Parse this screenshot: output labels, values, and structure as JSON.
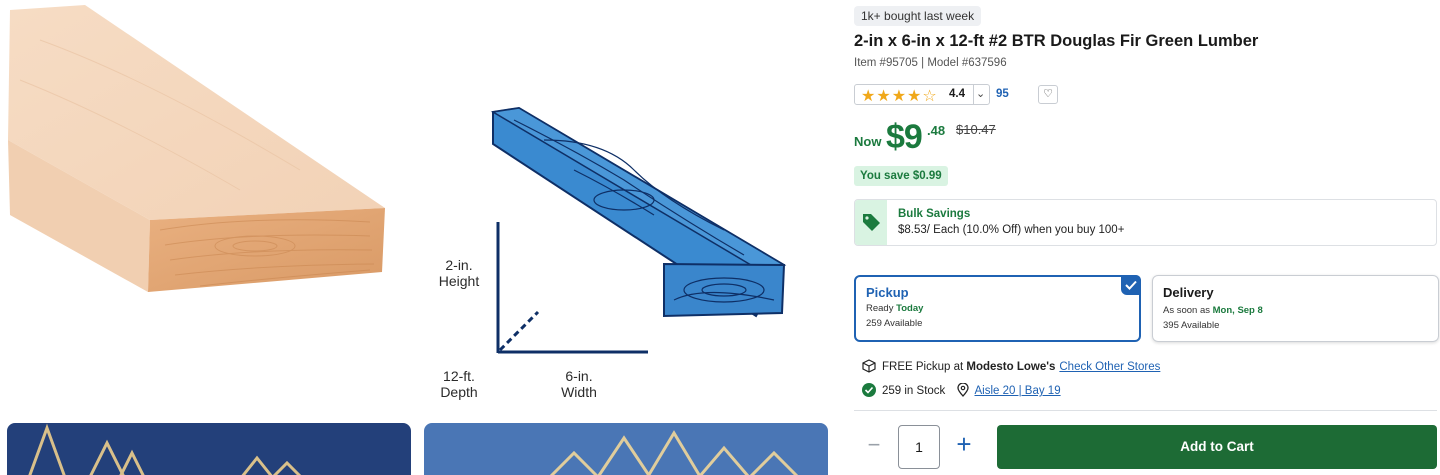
{
  "gallery": {
    "diagram": {
      "height_label": "2-in.\nHeight",
      "depth_label": "12-ft.\nDepth",
      "width_label": "6-in.\nWidth"
    }
  },
  "product": {
    "badge": "1k+ bought last week",
    "title": "2-in x 6-in x 12-ft #2 BTR Douglas Fir Green Lumber",
    "item_line": "Item #95705 | Model #637596",
    "rating": "4.4",
    "review_count": "95",
    "price_prefix": "Now",
    "price_dollars": "$9",
    "price_cents": ".48",
    "price_was": "$10.47",
    "savings": "You save $0.99"
  },
  "bulk": {
    "title": "Bulk Savings",
    "text": "$8.53/ Each (10.0% Off) when you buy 100+"
  },
  "fulfillment": {
    "pickup": {
      "title": "Pickup",
      "ready_prefix": "Ready",
      "ready_value": "Today",
      "available": "259 Available"
    },
    "delivery": {
      "title": "Delivery",
      "eta_prefix": "As soon as",
      "eta_value": "Mon, Sep 8",
      "available": "395 Available"
    }
  },
  "store": {
    "pickup_prefix": "FREE Pickup at",
    "store_name": "Modesto Lowe's",
    "check_other": "Check Other Stores",
    "stock": "259 in Stock",
    "aisle": "Aisle 20 | Bay 19"
  },
  "cart": {
    "quantity": "1",
    "add_label": "Add to Cart"
  },
  "colors": {
    "brand_green": "#1b7a3e",
    "cart_green": "#1d6b35",
    "link_blue": "#1f62b3",
    "star": "#f0a81a"
  }
}
